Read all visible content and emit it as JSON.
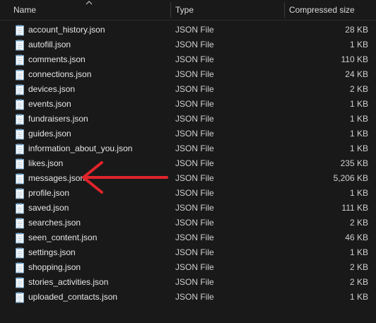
{
  "columns": {
    "name": "Name",
    "type": "Type",
    "compressed_size": "Compressed size"
  },
  "files": [
    {
      "name": "account_history.json",
      "type": "JSON File",
      "size": "28 KB"
    },
    {
      "name": "autofill.json",
      "type": "JSON File",
      "size": "1 KB"
    },
    {
      "name": "comments.json",
      "type": "JSON File",
      "size": "110 KB"
    },
    {
      "name": "connections.json",
      "type": "JSON File",
      "size": "24 KB"
    },
    {
      "name": "devices.json",
      "type": "JSON File",
      "size": "2 KB"
    },
    {
      "name": "events.json",
      "type": "JSON File",
      "size": "1 KB"
    },
    {
      "name": "fundraisers.json",
      "type": "JSON File",
      "size": "1 KB"
    },
    {
      "name": "guides.json",
      "type": "JSON File",
      "size": "1 KB"
    },
    {
      "name": "information_about_you.json",
      "type": "JSON File",
      "size": "1 KB"
    },
    {
      "name": "likes.json",
      "type": "JSON File",
      "size": "235 KB"
    },
    {
      "name": "messages.json",
      "type": "JSON File",
      "size": "5,206 KB"
    },
    {
      "name": "profile.json",
      "type": "JSON File",
      "size": "1 KB"
    },
    {
      "name": "saved.json",
      "type": "JSON File",
      "size": "111 KB"
    },
    {
      "name": "searches.json",
      "type": "JSON File",
      "size": "2 KB"
    },
    {
      "name": "seen_content.json",
      "type": "JSON File",
      "size": "46 KB"
    },
    {
      "name": "settings.json",
      "type": "JSON File",
      "size": "1 KB"
    },
    {
      "name": "shopping.json",
      "type": "JSON File",
      "size": "2 KB"
    },
    {
      "name": "stories_activities.json",
      "type": "JSON File",
      "size": "2 KB"
    },
    {
      "name": "uploaded_contacts.json",
      "type": "JSON File",
      "size": "1 KB"
    }
  ],
  "colors": {
    "background": "#191919",
    "arrow": "#e0242a",
    "icon": "#6f9fc4"
  },
  "icons": {
    "file": "json-file-icon",
    "sort": "sort-ascending-icon",
    "annotation": "red-arrow-annotation"
  }
}
